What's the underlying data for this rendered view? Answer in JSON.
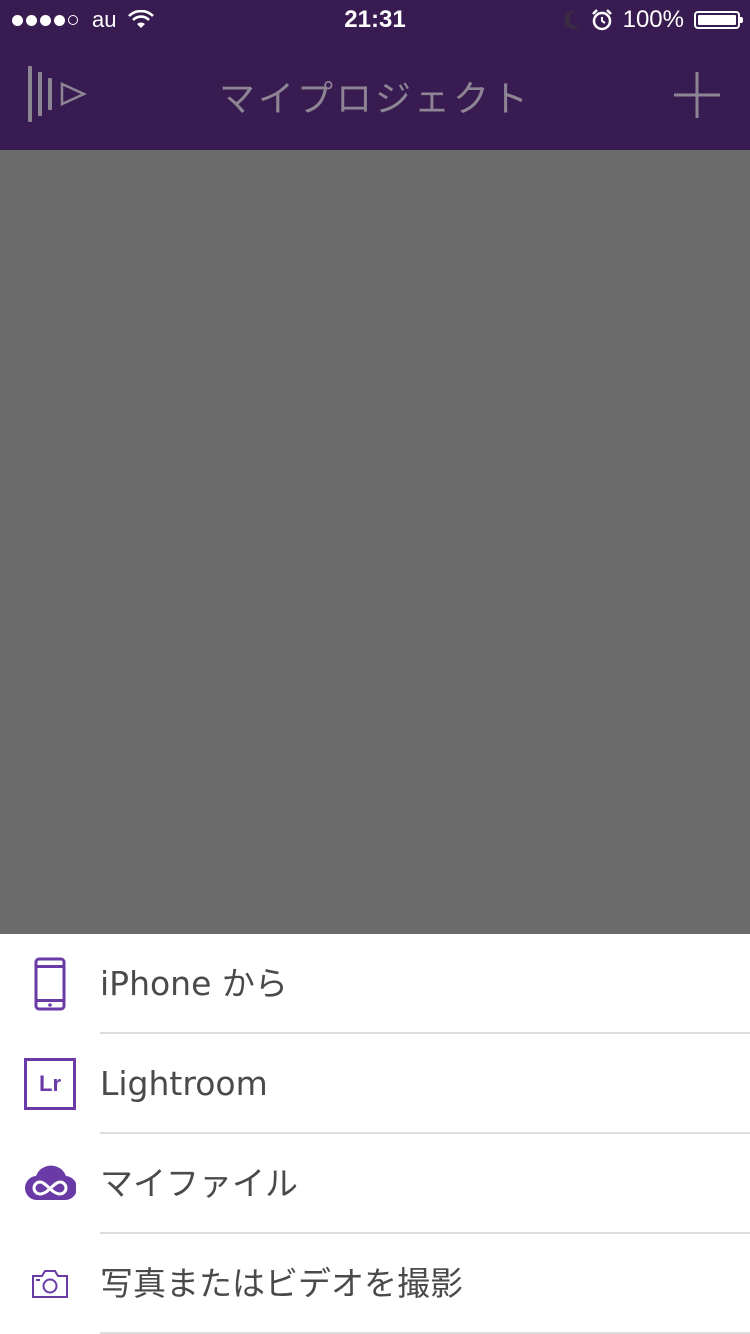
{
  "status_bar": {
    "carrier": "au",
    "time": "21:31",
    "battery": "100%"
  },
  "navbar": {
    "title": "マイプロジェクト",
    "left_icon": "app-logo-icon",
    "right_icon": "plus-icon"
  },
  "colors": {
    "bar_bg": "#381b50",
    "accent": "#6a3ba6",
    "dim_overlay": "#6b6b6b"
  },
  "sheet": {
    "items": [
      {
        "label": "iPhone から",
        "icon": "phone-icon"
      },
      {
        "label": "Lightroom",
        "icon": "lightroom-icon",
        "icon_text": "Lr"
      },
      {
        "label": "マイファイル",
        "icon": "creative-cloud-icon"
      },
      {
        "label": "写真またはビデオを撮影",
        "icon": "camera-icon"
      }
    ]
  }
}
